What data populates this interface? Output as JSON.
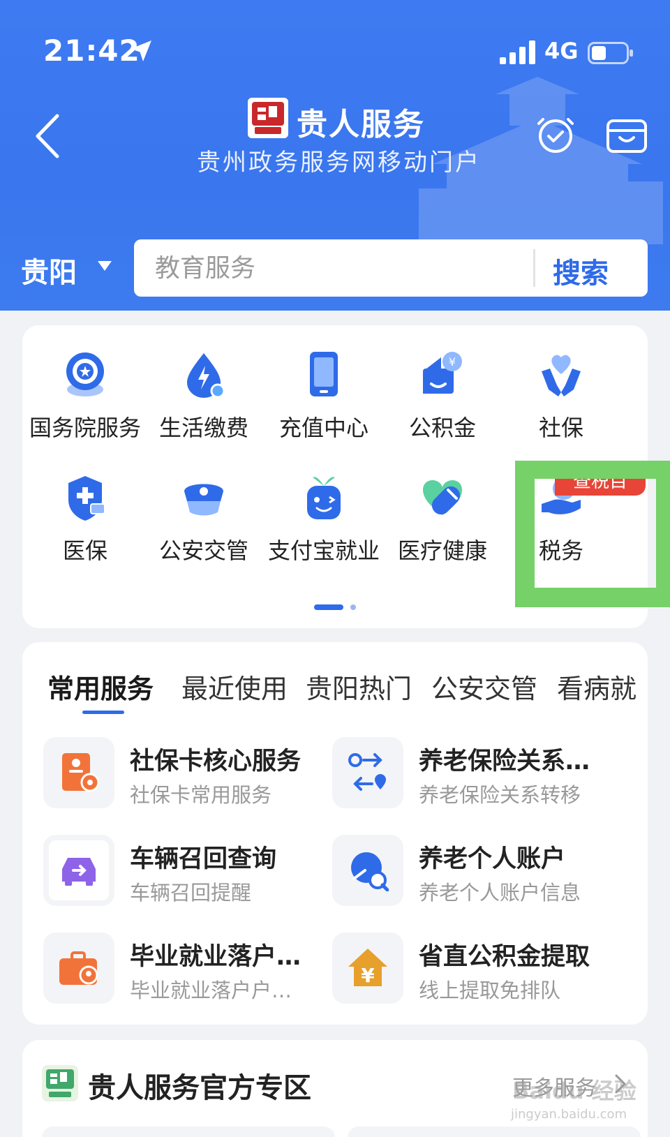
{
  "status_bar": {
    "time": "21:42",
    "network": "4G"
  },
  "header": {
    "brand_title": "贵人服务",
    "brand_subtitle": "贵州政务服务网移动门户",
    "logo_text": "贵人服务"
  },
  "search": {
    "city": "贵阳",
    "placeholder": "教育服务",
    "button": "搜索"
  },
  "services": [
    {
      "label": "国务院服务",
      "icon": "state-council-icon"
    },
    {
      "label": "生活缴费",
      "icon": "utility-payment-icon"
    },
    {
      "label": "充值中心",
      "icon": "phone-recharge-icon"
    },
    {
      "label": "公积金",
      "icon": "housing-fund-icon"
    },
    {
      "label": "社保",
      "icon": "social-security-icon"
    },
    {
      "label": "医保",
      "icon": "medical-insurance-icon"
    },
    {
      "label": "公安交管",
      "icon": "police-cap-icon"
    },
    {
      "label": "支付宝就业",
      "icon": "employment-robot-icon"
    },
    {
      "label": "医疗健康",
      "icon": "health-pill-icon"
    },
    {
      "label": "税务",
      "icon": "tax-hand-icon"
    }
  ],
  "tax_badge": "查税目",
  "pager": {
    "current": 1,
    "total": 2
  },
  "common": {
    "tabs": [
      "常用服务",
      "最近使用",
      "贵阳热门",
      "公安交管",
      "看病就"
    ],
    "items": [
      {
        "title": "社保卡核心服务",
        "subtitle": "社保卡常用服务",
        "icon": "social-card-icon"
      },
      {
        "title": "养老保险关系…",
        "subtitle": "养老保险关系转移",
        "icon": "transfer-route-icon"
      },
      {
        "title": "车辆召回查询",
        "subtitle": "车辆召回提醒",
        "icon": "car-recall-icon"
      },
      {
        "title": "养老个人账户",
        "subtitle": "养老个人账户信息",
        "icon": "account-search-icon"
      },
      {
        "title": "毕业就业落户…",
        "subtitle": "毕业就业落户户…",
        "icon": "briefcase-location-icon"
      },
      {
        "title": "省直公积金提取",
        "subtitle": "线上提取免排队",
        "icon": "house-yuan-icon"
      }
    ]
  },
  "zone": {
    "title": "贵人服务官方专区",
    "more": "更多服务"
  },
  "watermark": {
    "text": "Baidu 经验",
    "url": "jingyan.baidu.com"
  },
  "colors": {
    "primary": "#3e7af1",
    "accent": "#2f6be8",
    "badge": "#e84437",
    "highlight": "#76d168"
  }
}
